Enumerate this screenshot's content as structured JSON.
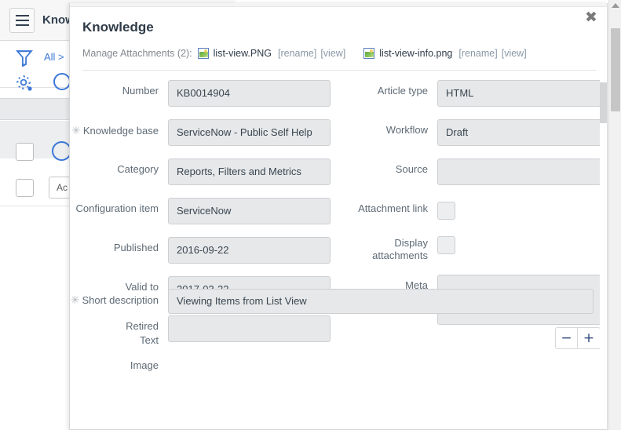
{
  "background": {
    "app_title": "Know",
    "hamburger_icon": "hamburger-menu-icon",
    "filter_icon": "filter-funnel-icon",
    "breadcrumb": "All >",
    "gear_icon": "gear-icon",
    "search_icon": "search-circle-icon",
    "action_button": "Ac"
  },
  "modal": {
    "heading": "Knowledge",
    "close_icon": "✖",
    "attachments": {
      "label": "Manage Attachments (2):",
      "items": [
        {
          "icon": "image-attachment-icon",
          "filename": "list-view.PNG",
          "rename": "[rename]",
          "view": "[view]"
        },
        {
          "icon": "image-attachment-icon",
          "filename": "list-view-info.png",
          "rename": "[rename]",
          "view": "[view]"
        }
      ]
    },
    "left_fields": [
      {
        "label": "Number",
        "required": false,
        "type": "input",
        "value": "KB0014904"
      },
      {
        "label": "Knowledge base",
        "required": true,
        "type": "input",
        "value": "ServiceNow - Public Self Help"
      },
      {
        "label": "Category",
        "required": false,
        "type": "input",
        "value": "Reports, Filters and Metrics"
      },
      {
        "label": "Configuration item",
        "required": false,
        "type": "input",
        "value": "ServiceNow"
      },
      {
        "label": "Published",
        "required": false,
        "type": "input",
        "value": "2016-09-22"
      },
      {
        "label": "Valid to",
        "required": false,
        "type": "input",
        "value": "2017-03-22"
      },
      {
        "label": "Retired",
        "required": false,
        "type": "input",
        "value": ""
      },
      {
        "label": "Image",
        "required": false,
        "type": "empty",
        "value": ""
      }
    ],
    "right_fields": [
      {
        "label": "Article type",
        "required": false,
        "type": "input",
        "value": "HTML"
      },
      {
        "label": "Workflow",
        "required": false,
        "type": "input",
        "value": "Draft"
      },
      {
        "label": "Source",
        "required": false,
        "type": "input",
        "value": ""
      },
      {
        "label": "Attachment link",
        "required": false,
        "type": "checkbox",
        "value": ""
      },
      {
        "label": "Display attachments",
        "required": false,
        "type": "checkbox",
        "value": ""
      },
      {
        "label": "Meta",
        "required": false,
        "type": "textarea",
        "value": ""
      }
    ],
    "short_description": {
      "label": "Short description",
      "required": true,
      "value": "Viewing Items from List View"
    },
    "text_field": {
      "label": "Text"
    },
    "zoom_controls": {
      "minus": "−",
      "plus": "+"
    },
    "required_marker": "✳"
  },
  "colors": {
    "accent_blue": "#3c78d8",
    "label_gray": "#5e6a75",
    "input_bg": "#e6e8ea",
    "heading": "#2f3b48",
    "link_gray": "#8a98a6"
  }
}
